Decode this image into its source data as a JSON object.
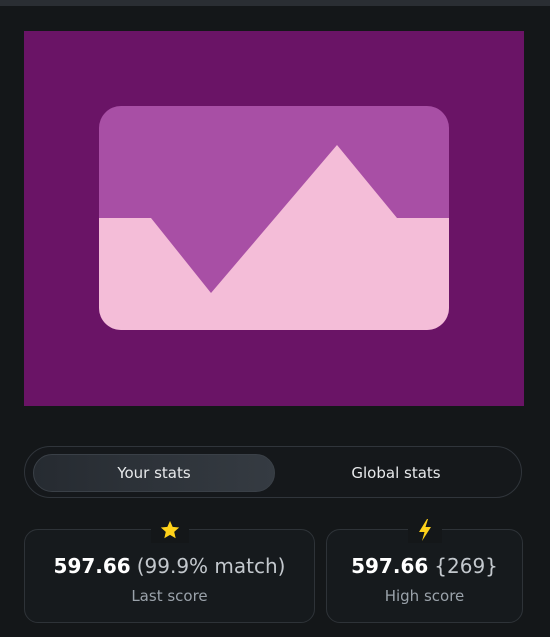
{
  "colors": {
    "preview_background": "#6a1466",
    "panel_upper": "#a84fa5",
    "panel_lower": "#f4bdd8",
    "star": "#ffd21a",
    "bolt": "#ffd21a"
  },
  "preview": {
    "image_icon": "image-placeholder-icon"
  },
  "tabs": [
    {
      "label": "Your stats",
      "active": true
    },
    {
      "label": "Global stats",
      "active": false
    }
  ],
  "cards": {
    "last": {
      "icon": "star-icon",
      "score": "597.66",
      "detail": "(99.9% match)",
      "label": "Last score"
    },
    "high": {
      "icon": "lightning-icon",
      "score": "597.66",
      "detail": "{269}",
      "label": "High score"
    }
  }
}
